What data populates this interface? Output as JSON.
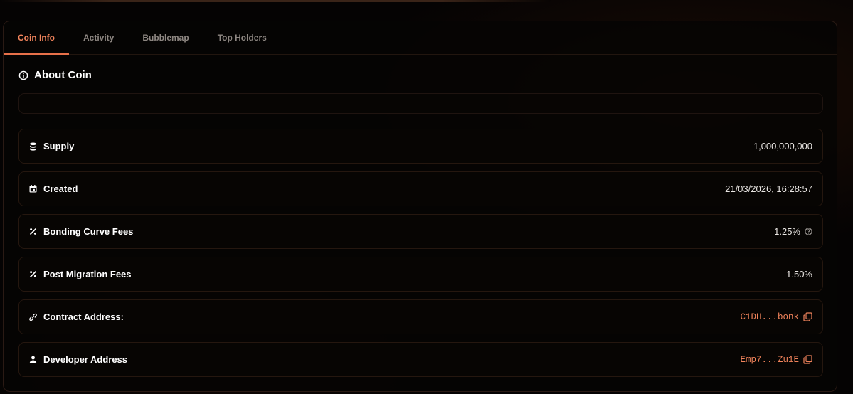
{
  "tabs": [
    {
      "label": "Coin Info",
      "active": true
    },
    {
      "label": "Activity",
      "active": false
    },
    {
      "label": "Bubblemap",
      "active": false
    },
    {
      "label": "Top Holders",
      "active": false
    }
  ],
  "about": {
    "title": "About Coin",
    "icon": "info-icon",
    "description": ""
  },
  "rows": [
    {
      "label": "Supply",
      "icon": "database-icon",
      "value": "1,000,000,000"
    },
    {
      "label": "Created",
      "icon": "calendar-icon",
      "value": "21/03/2026, 16:28:57"
    },
    {
      "label": "Bonding Curve Fees",
      "icon": "percent-icon",
      "value": "1.25%",
      "trailing_icon": "help-icon"
    },
    {
      "label": "Post Migration Fees",
      "icon": "percent-icon",
      "value": "1.50%"
    },
    {
      "label": "Contract Address:",
      "icon": "link-icon",
      "value": "C1DH...bonk",
      "trailing_icon": "copy-icon"
    },
    {
      "label": "Developer Address",
      "icon": "user-icon",
      "value": "Emp7...Zu1E",
      "trailing_icon": "copy-icon"
    }
  ],
  "colors": {
    "accent": "#e8714a",
    "address": "#f0835b",
    "text": "#ffffff",
    "muted": "#8e8782"
  }
}
